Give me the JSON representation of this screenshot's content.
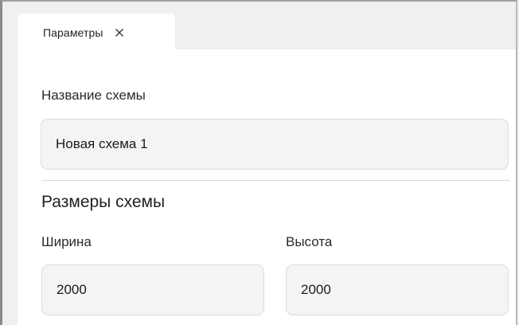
{
  "tab": {
    "label": "Параметры",
    "close_icon": "close-icon"
  },
  "scheme": {
    "name_label": "Название схемы",
    "name_value": "Новая схема 1"
  },
  "size": {
    "section_title": "Размеры схемы",
    "width_label": "Ширина",
    "width_value": "2000",
    "height_label": "Высота",
    "height_value": "2000"
  }
}
